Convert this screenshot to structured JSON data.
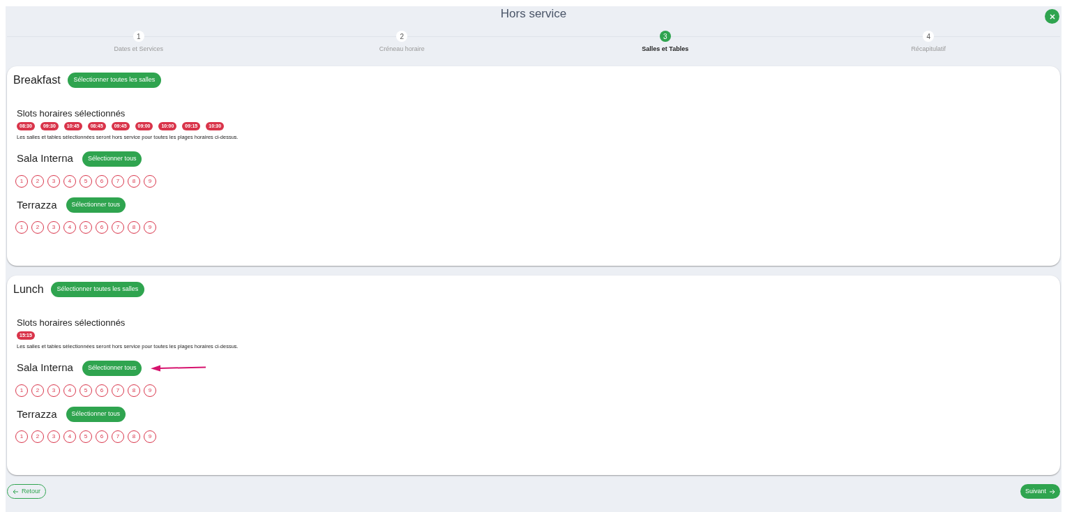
{
  "title": "Hors service",
  "steps": [
    {
      "number": "1",
      "label": "Dates et Services",
      "selected": false
    },
    {
      "number": "2",
      "label": "Créneau horaire",
      "selected": false
    },
    {
      "number": "3",
      "label": "Salles et Tables",
      "selected": true
    },
    {
      "number": "4",
      "label": "Récapitulatif",
      "selected": false
    }
  ],
  "services": [
    {
      "name": "Breakfast",
      "select_all": "Sélectionner toutes les salles",
      "slots_title": "Slots horaires sélectionnés",
      "slots": [
        "08:30",
        "09:30",
        "10:45",
        "08:45",
        "09:45",
        "09:00",
        "10:00",
        "09:15",
        "10:30"
      ],
      "note": "Les salles et tables sélectionnées seront hors service pour toutes les plages horaires ci-dessus.",
      "rooms": [
        {
          "name": "Sala Interna",
          "button": "Sélectionner tous",
          "annotation_arrow": false,
          "tables": [
            {
              "label": "1",
              "selected": false
            },
            {
              "label": "2",
              "selected": false
            },
            {
              "label": "3",
              "selected": false
            },
            {
              "label": "4",
              "selected": false
            },
            {
              "label": "5",
              "selected": false
            },
            {
              "label": "6",
              "selected": false
            },
            {
              "label": "7",
              "selected": false
            },
            {
              "label": "8",
              "selected": false
            },
            {
              "label": "9",
              "selected": false
            }
          ]
        },
        {
          "name": "Terrazza",
          "button": "Sélectionner tous",
          "annotation_arrow": false,
          "tables": [
            {
              "label": "1",
              "selected": false
            },
            {
              "label": "2",
              "selected": false
            },
            {
              "label": "3",
              "selected": false
            },
            {
              "label": "4",
              "selected": false
            },
            {
              "label": "5",
              "selected": false
            },
            {
              "label": "6",
              "selected": false
            },
            {
              "label": "7",
              "selected": false
            },
            {
              "label": "8",
              "selected": false
            },
            {
              "label": "9",
              "selected": false
            }
          ]
        }
      ]
    },
    {
      "name": "Lunch",
      "select_all": "Sélectionner toutes les salles",
      "slots_title": "Slots horaires sélectionnés",
      "slots": [
        "15:15"
      ],
      "note": "Les salles et tables sélectionnées seront hors service pour toutes les plages horaires ci-dessus.",
      "rooms": [
        {
          "name": "Sala Interna",
          "button": "Sélectionner tous",
          "annotation_arrow": true,
          "tables": [
            {
              "label": "1",
              "selected": false
            },
            {
              "label": "2",
              "selected": false
            },
            {
              "label": "3",
              "selected": false
            },
            {
              "label": "4",
              "selected": false
            },
            {
              "label": "5",
              "selected": false
            },
            {
              "label": "6",
              "selected": false
            },
            {
              "label": "7",
              "selected": false
            },
            {
              "label": "8",
              "selected": false
            },
            {
              "label": "9",
              "selected": false
            }
          ]
        },
        {
          "name": "Terrazza",
          "button": "Sélectionner tous",
          "annotation_arrow": false,
          "tables": [
            {
              "label": "1",
              "selected": false
            },
            {
              "label": "2",
              "selected": false
            },
            {
              "label": "3",
              "selected": false
            },
            {
              "label": "4",
              "selected": false
            },
            {
              "label": "5",
              "selected": false
            },
            {
              "label": "6",
              "selected": false
            },
            {
              "label": "7",
              "selected": false
            },
            {
              "label": "8",
              "selected": false
            },
            {
              "label": "9",
              "selected": false
            }
          ]
        }
      ]
    }
  ],
  "back_button": "Retour",
  "next_button": "Suivant"
}
